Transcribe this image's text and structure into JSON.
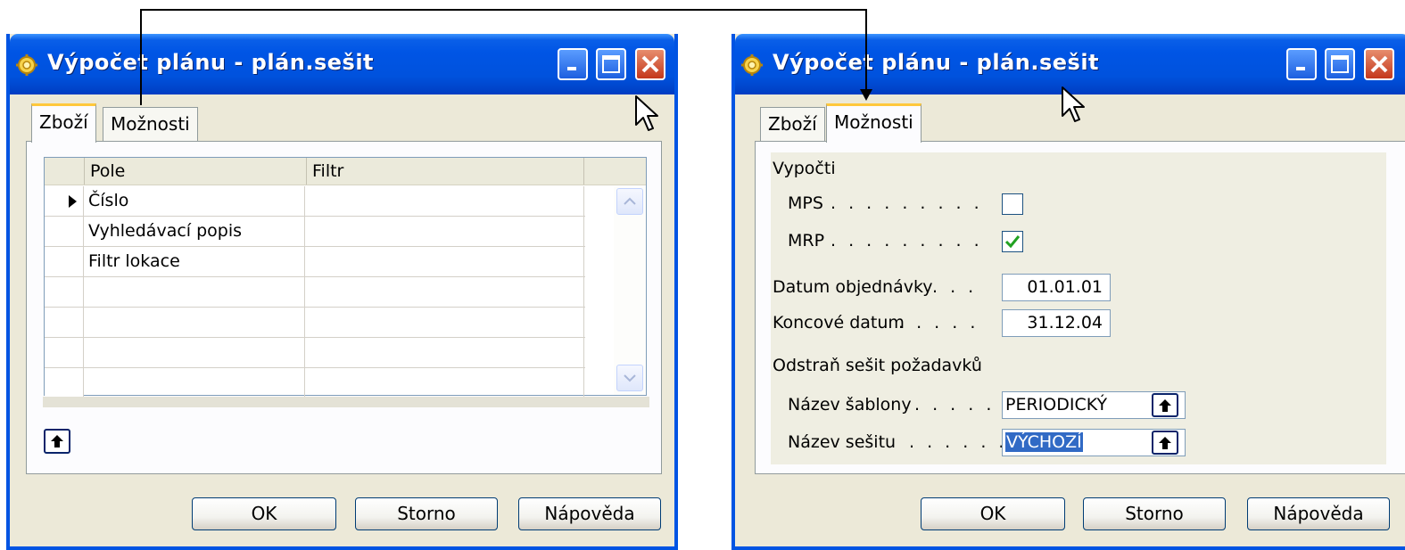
{
  "left_window": {
    "title": "Výpočet plánu - plán.sešit",
    "tabs": [
      "Zboží",
      "Možnosti"
    ],
    "active_tab": "Zboží",
    "grid": {
      "columns": [
        "Pole",
        "Filtr"
      ],
      "rows": [
        {
          "field": "Číslo",
          "filter": ""
        },
        {
          "field": "Vyhledávací popis",
          "filter": ""
        },
        {
          "field": "Filtr lokace",
          "filter": ""
        },
        {
          "field": "",
          "filter": ""
        },
        {
          "field": "",
          "filter": ""
        },
        {
          "field": "",
          "filter": ""
        },
        {
          "field": "",
          "filter": ""
        }
      ],
      "current_row": 0
    },
    "buttons": {
      "ok": "OK",
      "cancel": "Storno",
      "help": "Nápověda"
    }
  },
  "right_window": {
    "title": "Výpočet plánu - plán.sešit",
    "tabs": [
      "Zboží",
      "Možnosti"
    ],
    "active_tab": "Možnosti",
    "options": {
      "calculate_heading": "Vypočti",
      "mps_label": "MPS",
      "mps_checked": false,
      "mrp_label": "MRP",
      "mrp_checked": true,
      "order_date_label": "Datum objednávky",
      "order_date": "01.01.01",
      "end_date_label": "Koncové datum",
      "end_date": "31.12.04",
      "delete_worksheet_heading": "Odstraň sešit požadavků",
      "template_name_label": "Název šablony",
      "template_name": "PERIODICKÝ",
      "worksheet_name_label": "Název sešitu",
      "worksheet_name": "VÝCHOZÍ"
    },
    "buttons": {
      "ok": "OK",
      "cancel": "Storno",
      "help": "Nápověda"
    }
  },
  "colors": {
    "titlebar": "#0055e5",
    "dialog_bg": "#ece9d8",
    "active_tab_accent": "#ffc83c",
    "selection": "#316ac5",
    "check": "#21a121"
  },
  "icons": [
    "settings-icon",
    "minimize-icon",
    "maximize-icon",
    "close-icon",
    "lookup-arrow-icon",
    "scroll-up-icon",
    "scroll-down-icon",
    "mouse-cursor-icon"
  ]
}
